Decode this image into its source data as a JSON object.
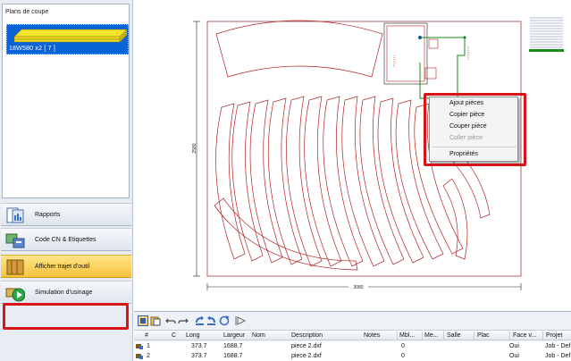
{
  "sidebar": {
    "panel_title": "Plans de coupe",
    "plan_item_label": "18W580 x2  [ 7 ]",
    "buttons": [
      {
        "label": "Rapports",
        "icon": "report-icon"
      },
      {
        "label": "Code CN & Etiquettes",
        "icon": "cnc-code-icon"
      },
      {
        "label": "Afficher trajet d'outil",
        "icon": "toolpath-icon"
      },
      {
        "label": "Simulation d'usinage",
        "icon": "simulation-icon"
      }
    ]
  },
  "canvas": {
    "dim_vertical": "2580",
    "dim_horizontal": "3080"
  },
  "context_menu": {
    "items": [
      {
        "label": "Ajout pièces",
        "enabled": true
      },
      {
        "label": "Copier pièce",
        "enabled": true
      },
      {
        "label": "Couper pièce",
        "enabled": true
      },
      {
        "label": "Coller pièce",
        "enabled": false
      },
      {
        "label": "Propriétés",
        "enabled": true
      }
    ]
  },
  "grid": {
    "columns": [
      "#",
      "C",
      "Long",
      "Largeur",
      "Nom",
      "Description",
      "Notes",
      "Mbl...",
      "Me...",
      "Salle",
      "Plac",
      "Face v...",
      "Projet"
    ],
    "rows": [
      {
        "num": "1",
        "length": "373.7",
        "width": "1688.7",
        "description": "piece 2.dxf",
        "qty": "0",
        "face": "Oui",
        "project": "Job - Def"
      },
      {
        "num": "2",
        "length": "373.7",
        "width": "1688.7",
        "description": "piece 2.dxf",
        "qty": "0",
        "face": "Oui",
        "project": "Job - Def"
      }
    ]
  },
  "colors": {
    "selection": "#0b63d8",
    "highlight": "#d8141b",
    "part_outline": "#b22222",
    "toolpath": "#1a8a1a",
    "active_button": "#f7c33b"
  }
}
